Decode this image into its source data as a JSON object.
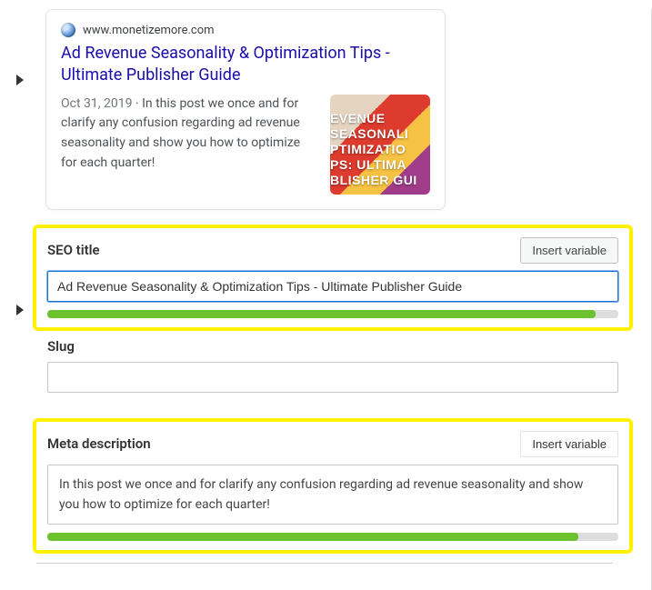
{
  "preview": {
    "domain": "www.monetizemore.com",
    "title": "Ad Revenue Seasonality & Optimization Tips - Ultimate Publisher Guide",
    "date": "Oct 31, 2019",
    "description": "In this post we once and for clarify any confusion regarding ad revenue seasonality and show you how to optimize for each quarter!",
    "thumb_lines": [
      "EVENUE SEASONALI",
      "PTIMIZATIO",
      "PS: ULTIMA",
      "BLISHER GUI"
    ]
  },
  "fields": {
    "seo_title": {
      "label": "SEO title",
      "insert": "Insert variable",
      "value": "Ad Revenue Seasonality & Optimization Tips - Ultimate Publisher Guide",
      "progress": 96
    },
    "slug": {
      "label": "Slug",
      "value": ""
    },
    "meta": {
      "label": "Meta description",
      "insert": "Insert variable",
      "value": "In this post we once and for clarify any confusion regarding ad revenue seasonality and show you how to optimize for each quarter!",
      "progress": 93
    }
  }
}
